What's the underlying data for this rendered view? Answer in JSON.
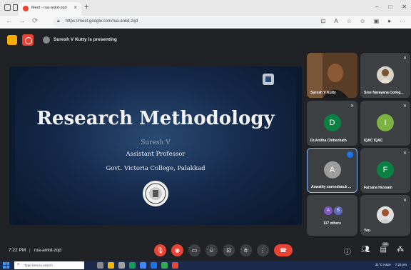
{
  "browser": {
    "tab_title": "Meet - rua-ankd-zqd",
    "tab_close": "×",
    "new_tab": "+",
    "window_controls": [
      "–",
      "□",
      "✕"
    ],
    "url": "https://meet.google.com/rua-ankd-zqd"
  },
  "meet": {
    "presenting_text": "Suresh V Kutty is presenting"
  },
  "slide": {
    "title": "Research Methodology",
    "presenter_name": "Suresh V",
    "role": "Assistant Professor",
    "institution": "Govt. Victoria College, Palakkad"
  },
  "participants": [
    {
      "name": "Suresh V Kutty",
      "type": "video",
      "bg": "#6b4a2c"
    },
    {
      "name": "Sree Narayana Colleg...",
      "type": "photo",
      "bg": "#3c4043"
    },
    {
      "name": "Dr.Anitha Chittezhath",
      "type": "initial",
      "initial": "D",
      "color": "#0b8043"
    },
    {
      "name": "IQAC IQAC",
      "type": "initial",
      "initial": "I",
      "color": "#7cb342"
    },
    {
      "name": "Aswathy surendran.k ...",
      "type": "initial",
      "initial": "A",
      "color": "#9e9e9e",
      "active": true
    },
    {
      "name": "Farzana Hussain",
      "type": "initial",
      "initial": "F",
      "color": "#0b8043"
    },
    {
      "name": "117 others",
      "type": "others",
      "initials": [
        "A",
        "B"
      ]
    },
    {
      "name": "You",
      "type": "photo",
      "bg": "#3c4043"
    }
  ],
  "bottom": {
    "time": "7:22 PM",
    "separator": "|",
    "meeting_code": "rua-ankd-zqd",
    "people_count": "125"
  },
  "taskbar": {
    "search_placeholder": "Type here to search",
    "weather": "31°C Haze",
    "clock": "7:22 pm"
  },
  "colors": {
    "meet_red": "#ea4335",
    "meet_bg": "#202124",
    "tile_bg": "#3c4043",
    "active_border": "#8ab4f8"
  }
}
